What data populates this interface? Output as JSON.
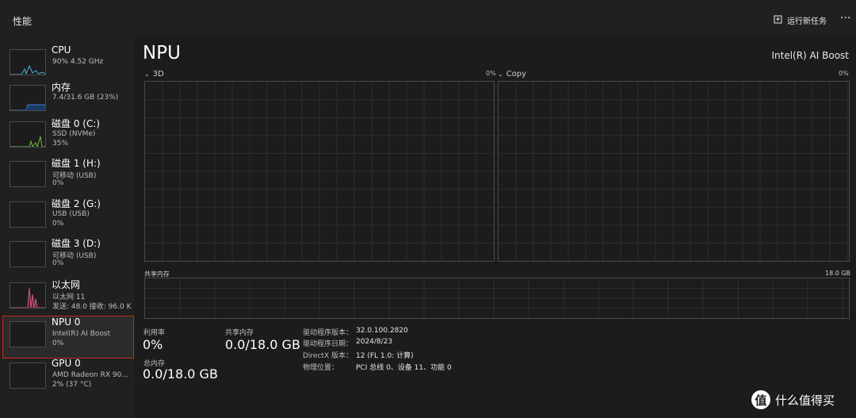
{
  "app": {
    "title": "性能"
  },
  "toolbar": {
    "run_task_label": "运行新任务",
    "more_label": "···"
  },
  "sidebar": {
    "items": [
      {
        "name": "CPU",
        "sub1": "90%  4.52 GHz",
        "sub2": ""
      },
      {
        "name": "内存",
        "sub1": "7.4/31.6 GB (23%)",
        "sub2": ""
      },
      {
        "name": "磁盘 0 (C:)",
        "sub1": "SSD (NVMe)",
        "sub2": "35%"
      },
      {
        "name": "磁盘 1 (H:)",
        "sub1": "可移动 (USB)",
        "sub2": "0%"
      },
      {
        "name": "磁盘 2 (G:)",
        "sub1": "USB (USB)",
        "sub2": "0%"
      },
      {
        "name": "磁盘 3 (D:)",
        "sub1": "可移动 (USB)",
        "sub2": "0%"
      },
      {
        "name": "以太网",
        "sub1": "以太网 11",
        "sub2": "发送: 48.0  接收: 96.0 K"
      },
      {
        "name": "NPU 0",
        "sub1": "Intel(R) AI Boost",
        "sub2": "0%"
      },
      {
        "name": "GPU 0",
        "sub1": "AMD Radeon RX 90...",
        "sub2": "2% (37 °C)"
      }
    ]
  },
  "main": {
    "title": "NPU",
    "device": "Intel(R) AI Boost",
    "graphs": [
      {
        "label": "3D",
        "value": "0%"
      },
      {
        "label": "Copy",
        "value": "0%"
      }
    ],
    "shared_memory": {
      "label": "共享内存",
      "max": "18.0 GB"
    },
    "stats": {
      "utilization": {
        "label": "利用率",
        "value": "0%"
      },
      "shared_mem": {
        "label": "共享内存",
        "value": "0.0/18.0 GB"
      },
      "total_mem": {
        "label": "总内存",
        "value": "0.0/18.0 GB"
      }
    },
    "info": [
      {
        "key": "驱动程序版本：",
        "value": "32.0.100.2820"
      },
      {
        "key": "驱动程序日期：",
        "value": "2024/8/23"
      },
      {
        "key": "DirectX 版本：",
        "value": "12 (FL 1.0: 计算)"
      },
      {
        "key": "物理位置：",
        "value": "PCI 总线 0、设备 11、功能 0"
      }
    ]
  },
  "watermark": {
    "badge": "值",
    "text": "什么值得买"
  },
  "colors": {
    "cpu": "#4fb3d9",
    "memory": "#3a7bd5",
    "disk": "#6fbf3a",
    "ethernet": "#d05a8a",
    "selected_border": "#c42b1c"
  }
}
